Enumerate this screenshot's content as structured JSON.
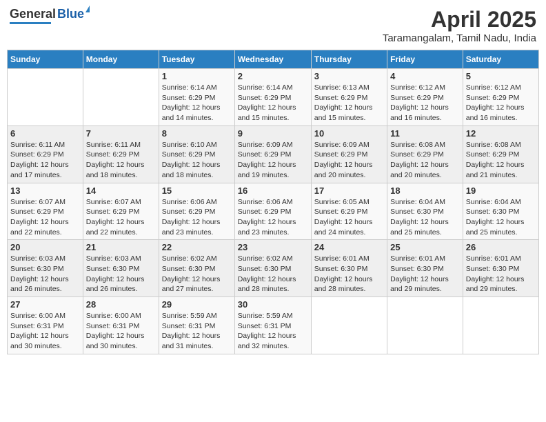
{
  "header": {
    "logo_general": "General",
    "logo_blue": "Blue",
    "title": "April 2025",
    "subtitle": "Taramangalam, Tamil Nadu, India"
  },
  "calendar": {
    "days_of_week": [
      "Sunday",
      "Monday",
      "Tuesday",
      "Wednesday",
      "Thursday",
      "Friday",
      "Saturday"
    ],
    "weeks": [
      [
        {
          "day": "",
          "info": ""
        },
        {
          "day": "",
          "info": ""
        },
        {
          "day": "1",
          "info": "Sunrise: 6:14 AM\nSunset: 6:29 PM\nDaylight: 12 hours and 14 minutes."
        },
        {
          "day": "2",
          "info": "Sunrise: 6:14 AM\nSunset: 6:29 PM\nDaylight: 12 hours and 15 minutes."
        },
        {
          "day": "3",
          "info": "Sunrise: 6:13 AM\nSunset: 6:29 PM\nDaylight: 12 hours and 15 minutes."
        },
        {
          "day": "4",
          "info": "Sunrise: 6:12 AM\nSunset: 6:29 PM\nDaylight: 12 hours and 16 minutes."
        },
        {
          "day": "5",
          "info": "Sunrise: 6:12 AM\nSunset: 6:29 PM\nDaylight: 12 hours and 16 minutes."
        }
      ],
      [
        {
          "day": "6",
          "info": "Sunrise: 6:11 AM\nSunset: 6:29 PM\nDaylight: 12 hours and 17 minutes."
        },
        {
          "day": "7",
          "info": "Sunrise: 6:11 AM\nSunset: 6:29 PM\nDaylight: 12 hours and 18 minutes."
        },
        {
          "day": "8",
          "info": "Sunrise: 6:10 AM\nSunset: 6:29 PM\nDaylight: 12 hours and 18 minutes."
        },
        {
          "day": "9",
          "info": "Sunrise: 6:09 AM\nSunset: 6:29 PM\nDaylight: 12 hours and 19 minutes."
        },
        {
          "day": "10",
          "info": "Sunrise: 6:09 AM\nSunset: 6:29 PM\nDaylight: 12 hours and 20 minutes."
        },
        {
          "day": "11",
          "info": "Sunrise: 6:08 AM\nSunset: 6:29 PM\nDaylight: 12 hours and 20 minutes."
        },
        {
          "day": "12",
          "info": "Sunrise: 6:08 AM\nSunset: 6:29 PM\nDaylight: 12 hours and 21 minutes."
        }
      ],
      [
        {
          "day": "13",
          "info": "Sunrise: 6:07 AM\nSunset: 6:29 PM\nDaylight: 12 hours and 22 minutes."
        },
        {
          "day": "14",
          "info": "Sunrise: 6:07 AM\nSunset: 6:29 PM\nDaylight: 12 hours and 22 minutes."
        },
        {
          "day": "15",
          "info": "Sunrise: 6:06 AM\nSunset: 6:29 PM\nDaylight: 12 hours and 23 minutes."
        },
        {
          "day": "16",
          "info": "Sunrise: 6:06 AM\nSunset: 6:29 PM\nDaylight: 12 hours and 23 minutes."
        },
        {
          "day": "17",
          "info": "Sunrise: 6:05 AM\nSunset: 6:29 PM\nDaylight: 12 hours and 24 minutes."
        },
        {
          "day": "18",
          "info": "Sunrise: 6:04 AM\nSunset: 6:30 PM\nDaylight: 12 hours and 25 minutes."
        },
        {
          "day": "19",
          "info": "Sunrise: 6:04 AM\nSunset: 6:30 PM\nDaylight: 12 hours and 25 minutes."
        }
      ],
      [
        {
          "day": "20",
          "info": "Sunrise: 6:03 AM\nSunset: 6:30 PM\nDaylight: 12 hours and 26 minutes."
        },
        {
          "day": "21",
          "info": "Sunrise: 6:03 AM\nSunset: 6:30 PM\nDaylight: 12 hours and 26 minutes."
        },
        {
          "day": "22",
          "info": "Sunrise: 6:02 AM\nSunset: 6:30 PM\nDaylight: 12 hours and 27 minutes."
        },
        {
          "day": "23",
          "info": "Sunrise: 6:02 AM\nSunset: 6:30 PM\nDaylight: 12 hours and 28 minutes."
        },
        {
          "day": "24",
          "info": "Sunrise: 6:01 AM\nSunset: 6:30 PM\nDaylight: 12 hours and 28 minutes."
        },
        {
          "day": "25",
          "info": "Sunrise: 6:01 AM\nSunset: 6:30 PM\nDaylight: 12 hours and 29 minutes."
        },
        {
          "day": "26",
          "info": "Sunrise: 6:01 AM\nSunset: 6:30 PM\nDaylight: 12 hours and 29 minutes."
        }
      ],
      [
        {
          "day": "27",
          "info": "Sunrise: 6:00 AM\nSunset: 6:31 PM\nDaylight: 12 hours and 30 minutes."
        },
        {
          "day": "28",
          "info": "Sunrise: 6:00 AM\nSunset: 6:31 PM\nDaylight: 12 hours and 30 minutes."
        },
        {
          "day": "29",
          "info": "Sunrise: 5:59 AM\nSunset: 6:31 PM\nDaylight: 12 hours and 31 minutes."
        },
        {
          "day": "30",
          "info": "Sunrise: 5:59 AM\nSunset: 6:31 PM\nDaylight: 12 hours and 32 minutes."
        },
        {
          "day": "",
          "info": ""
        },
        {
          "day": "",
          "info": ""
        },
        {
          "day": "",
          "info": ""
        }
      ]
    ]
  }
}
